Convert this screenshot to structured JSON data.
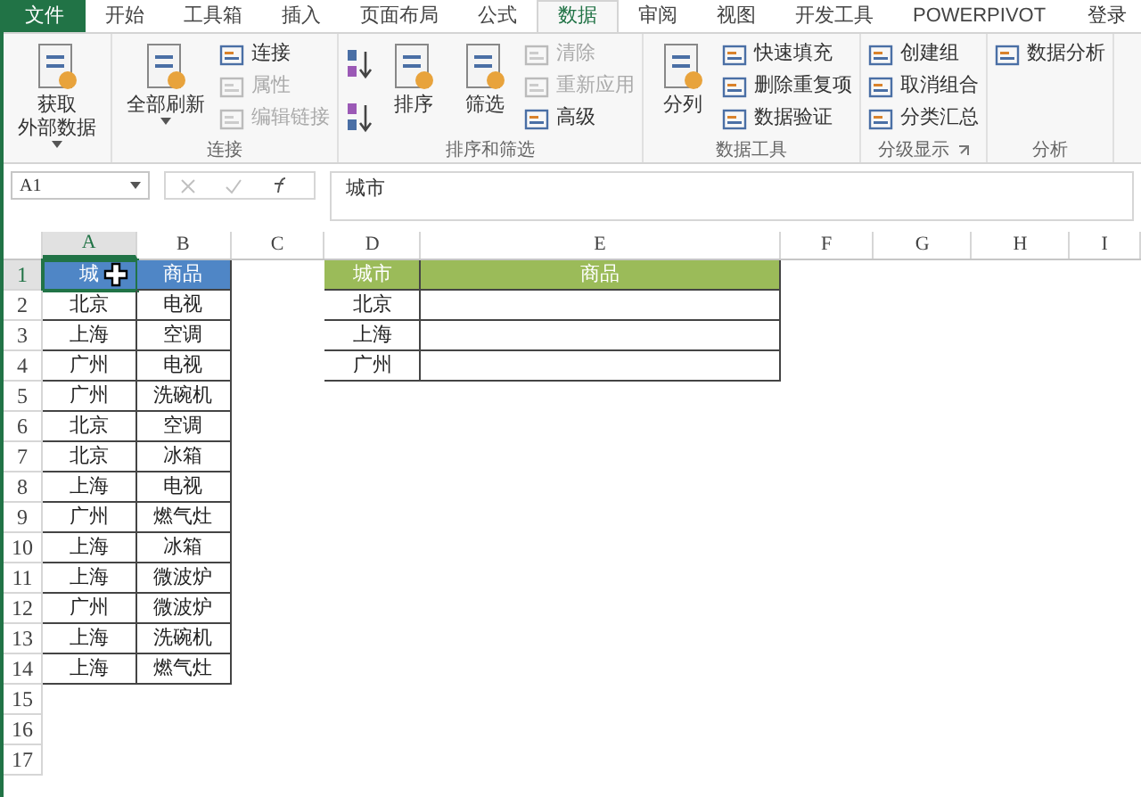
{
  "tabs": [
    {
      "label": "文件",
      "kind": "file",
      "selected": false
    },
    {
      "label": "开始",
      "kind": "tab",
      "selected": false
    },
    {
      "label": "工具箱",
      "kind": "tab",
      "selected": false
    },
    {
      "label": "插入",
      "kind": "tab",
      "selected": false
    },
    {
      "label": "页面布局",
      "kind": "tab",
      "selected": false
    },
    {
      "label": "公式",
      "kind": "tab",
      "selected": false
    },
    {
      "label": "数据",
      "kind": "tab",
      "selected": true
    },
    {
      "label": "审阅",
      "kind": "tab",
      "selected": false
    },
    {
      "label": "视图",
      "kind": "tab",
      "selected": false
    },
    {
      "label": "开发工具",
      "kind": "tab",
      "selected": false
    },
    {
      "label": "POWERPIVOT",
      "kind": "tab",
      "selected": false
    }
  ],
  "account": "登录",
  "ribbon_groups": [
    {
      "large": [
        {
          "kind": "button",
          "label": "获取",
          "label2": "外部数据",
          "dropdown": true
        }
      ]
    },
    {
      "label": "连接",
      "large": [
        {
          "kind": "button",
          "label": "全部刷新",
          "dropdown": true
        }
      ],
      "small": [
        {
          "label": "连接",
          "disabled": false
        },
        {
          "label": "属性",
          "disabled": true
        },
        {
          "label": "编辑链接",
          "disabled": true
        }
      ]
    },
    {
      "label": "排序和筛选",
      "large": [
        {
          "kind": "sort_pair"
        },
        {
          "kind": "button",
          "label": "排序"
        },
        {
          "kind": "button",
          "label": "筛选"
        }
      ],
      "small": [
        {
          "label": "清除",
          "disabled": true
        },
        {
          "label": "重新应用",
          "disabled": true
        },
        {
          "label": "高级",
          "disabled": false
        }
      ]
    },
    {
      "label": "数据工具",
      "large": [
        {
          "kind": "button",
          "label": "分列"
        }
      ],
      "small": [
        {
          "label": "快速填充",
          "disabled": false
        },
        {
          "label": "删除重复项",
          "disabled": false
        },
        {
          "label": "数据验证",
          "disabled": false
        }
      ]
    },
    {
      "label": "分级显示",
      "launcher": true,
      "small": [
        {
          "label": "创建组",
          "disabled": false
        },
        {
          "label": "取消组合",
          "disabled": false
        },
        {
          "label": "分类汇总",
          "disabled": false
        }
      ]
    },
    {
      "label": "分析",
      "small": [
        {
          "label": "数据分析",
          "disabled": false
        }
      ]
    }
  ],
  "name_box": "A1",
  "formula": "城市",
  "columns": [
    {
      "label": "A",
      "selected": true
    },
    {
      "label": "B",
      "selected": false
    },
    {
      "label": "C",
      "selected": false
    },
    {
      "label": "D",
      "selected": false
    },
    {
      "label": "E",
      "selected": false
    },
    {
      "label": "F",
      "selected": false
    },
    {
      "label": "G",
      "selected": false
    },
    {
      "label": "H",
      "selected": false
    },
    {
      "label": "I",
      "selected": false
    }
  ],
  "rows": [
    {
      "label": "1",
      "selected": true
    },
    {
      "label": "2",
      "selected": false
    },
    {
      "label": "3",
      "selected": false
    },
    {
      "label": "4",
      "selected": false
    },
    {
      "label": "5",
      "selected": false
    },
    {
      "label": "6",
      "selected": false
    },
    {
      "label": "7",
      "selected": false
    },
    {
      "label": "8",
      "selected": false
    },
    {
      "label": "9",
      "selected": false
    },
    {
      "label": "10",
      "selected": false
    },
    {
      "label": "11",
      "selected": false
    },
    {
      "label": "12",
      "selected": false
    },
    {
      "label": "13",
      "selected": false
    },
    {
      "label": "14",
      "selected": false
    },
    {
      "label": "15",
      "selected": false
    },
    {
      "label": "16",
      "selected": false
    },
    {
      "label": "17",
      "selected": false
    }
  ],
  "source_table": {
    "headers": [
      "城",
      "商品"
    ],
    "rows": [
      [
        "北京",
        "电视"
      ],
      [
        "上海",
        "空调"
      ],
      [
        "广州",
        "电视"
      ],
      [
        "广州",
        "洗碗机"
      ],
      [
        "北京",
        "空调"
      ],
      [
        "北京",
        "冰箱"
      ],
      [
        "上海",
        "电视"
      ],
      [
        "广州",
        "燃气灶"
      ],
      [
        "上海",
        "冰箱"
      ],
      [
        "上海",
        "微波炉"
      ],
      [
        "广州",
        "微波炉"
      ],
      [
        "上海",
        "洗碗机"
      ],
      [
        "上海",
        "燃气灶"
      ]
    ]
  },
  "lookup_table": {
    "headers": [
      "城市",
      "商品"
    ],
    "rows": [
      [
        "北京"
      ],
      [
        "上海"
      ],
      [
        "广州"
      ]
    ]
  }
}
